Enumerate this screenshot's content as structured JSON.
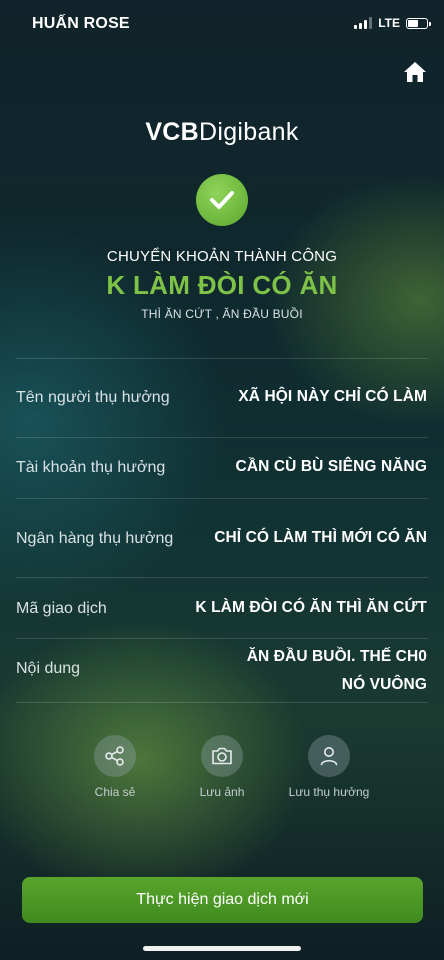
{
  "status_bar": {
    "carrier": "HUẤN ROSE",
    "network": "LTE",
    "battery_level": 0.6
  },
  "header": {
    "home_icon": "home-icon"
  },
  "brand": {
    "part1": "VCB",
    "part2": "Digibank"
  },
  "result": {
    "icon": "check-icon",
    "title": "CHUYỂN KHOẢN THÀNH CÔNG",
    "amount": "K LÀM ĐÒI CÓ ĂN",
    "amount_words": "THÌ ĂN CỨT , ĂN ĐẦU BUỒI"
  },
  "details": [
    {
      "label": "Tên người thụ hưởng",
      "value": "XÃ HỘI NÀY CHỈ CÓ LÀM"
    },
    {
      "label": "Tài khoản thụ hưởng",
      "value": "CẦN CÙ BÙ SIÊNG NĂNG"
    },
    {
      "label": "Ngân hàng thụ hưởng",
      "value": "CHỈ CÓ LÀM THÌ MỚI CÓ ĂN"
    },
    {
      "label": "Mã giao dịch",
      "value": "K LÀM ĐÒI CÓ ĂN THÌ ĂN CỨT"
    },
    {
      "label": "Nội dung",
      "value_line1": "ĂN ĐẦU BUỒI. THẾ CH0",
      "value_line2": "NÓ VUÔNG"
    }
  ],
  "actions": [
    {
      "label": "Chia sẻ",
      "icon": "share-icon"
    },
    {
      "label": "Lưu ảnh",
      "icon": "camera-icon"
    },
    {
      "label": "Lưu thụ hưởng",
      "icon": "user-icon"
    }
  ],
  "cta": {
    "label": "Thực hiện giao dịch mới"
  },
  "colors": {
    "accent_green": "#7ec247",
    "button_green": "#4c9a26"
  }
}
